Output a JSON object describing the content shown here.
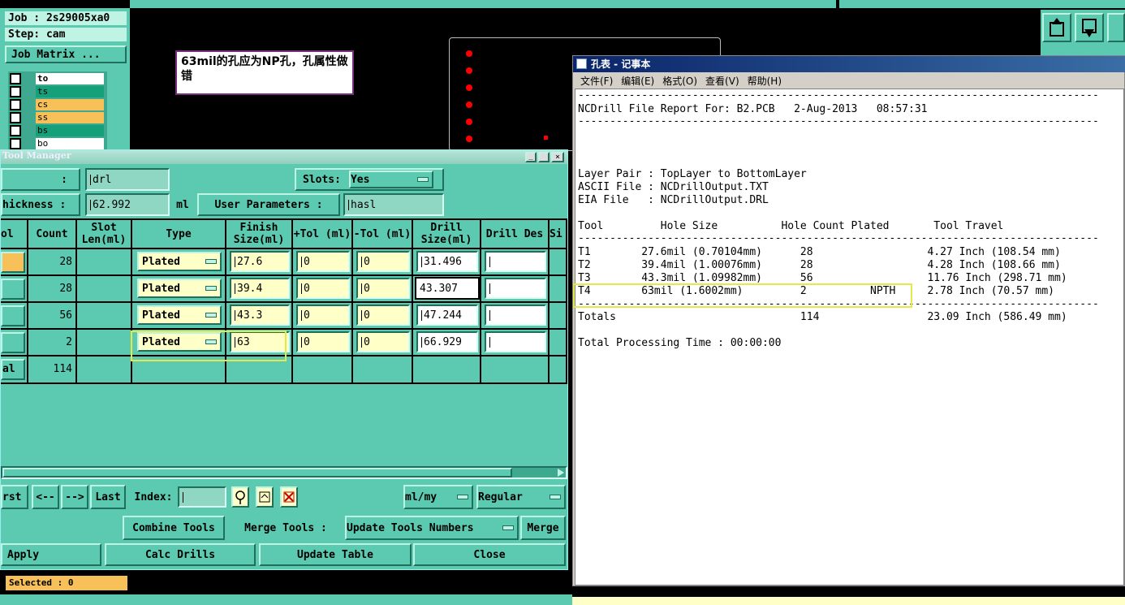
{
  "job_panel": {
    "job": "Job : 2s29005xa0",
    "step": "Step: cam",
    "matrix_button": "Job Matrix ..."
  },
  "layers": [
    "to",
    "ts",
    "cs",
    "ss",
    "bs",
    "bo"
  ],
  "annotation": "63mil的孔应为NP孔，孔属性做错",
  "tool_manager": {
    "title": "Tool Manager",
    "field_colon": ":",
    "drill_layer": "drl",
    "slots_label": "Slots:",
    "slots_value": "Yes",
    "thickness_label": "hickness :",
    "thickness_value": "62.992",
    "thickness_unit": "ml",
    "user_params_label": "User Parameters :",
    "user_params_value": "hasl",
    "columns": [
      "ol",
      "Count",
      "Slot Len(ml)",
      "Type",
      "Finish Size(ml)",
      "+Tol (ml)",
      "-Tol (ml)",
      "Drill Size(ml)",
      "Drill Des",
      "Si"
    ],
    "rows": [
      {
        "count": "28",
        "type": "Plated",
        "finish": "27.6",
        "ptol": "0",
        "ntol": "0",
        "drill": "31.496"
      },
      {
        "count": "28",
        "type": "Plated",
        "finish": "39.4",
        "ptol": "0",
        "ntol": "0",
        "drill": "43.307"
      },
      {
        "count": "56",
        "type": "Plated",
        "finish": "43.3",
        "ptol": "0",
        "ntol": "0",
        "drill": "47.244"
      },
      {
        "count": "2",
        "type": "Plated",
        "finish": "63",
        "ptol": "0",
        "ntol": "0",
        "drill": "66.929"
      }
    ],
    "total_label": "al",
    "total_count": "114",
    "nav": {
      "first": "rst",
      "prev": "<--",
      "next": "-->",
      "last": "Last",
      "index_label": "Index:",
      "units": "ml/my",
      "mode": "Regular"
    },
    "combine": "Combine Tools",
    "merge_label": "Merge Tools :",
    "update_numbers": "Update Tools Numbers",
    "merge": "Merge",
    "apply": "Apply",
    "calc": "Calc Drills",
    "update_table": "Update Table",
    "close": "Close"
  },
  "selected": "Selected : 0",
  "notepad": {
    "title": "孔表 - 记事本",
    "menu": [
      "文件(F)",
      "编辑(E)",
      "格式(O)",
      "查看(V)",
      "帮助(H)"
    ],
    "dash": "----------------------------------------------------------------------------------",
    "report": "NCDrill File Report For: B2.PCB   2-Aug-2013   08:57:31",
    "layer_pair": "Layer Pair : TopLayer to BottomLayer",
    "ascii": "ASCII File : NCDrillOutput.TXT",
    "eia": "EIA File   : NCDrillOutput.DRL",
    "header": "Tool         Hole Size          Hole Count Plated       Tool Travel",
    "t1": "T1        27.6mil (0.70104mm)      28                  4.27 Inch (108.54 mm)",
    "t2": "T2        39.4mil (1.00076mm)      28                  4.28 Inch (108.66 mm)",
    "t3": "T3        43.3mil (1.09982mm)      56                  11.76 Inch (298.71 mm)",
    "t4": "T4        63mil (1.6002mm)         2          NPTH     2.78 Inch (70.57 mm)",
    "totals": "Totals                             114                 23.09 Inch (586.49 mm)",
    "time": "Total Processing Time : 00:00:00"
  },
  "colors": {
    "panel": "#5ccab0",
    "field": "#ffffc8",
    "orange": "#f8c058",
    "green": "#16a07a",
    "highlight": "#e6e84a"
  }
}
